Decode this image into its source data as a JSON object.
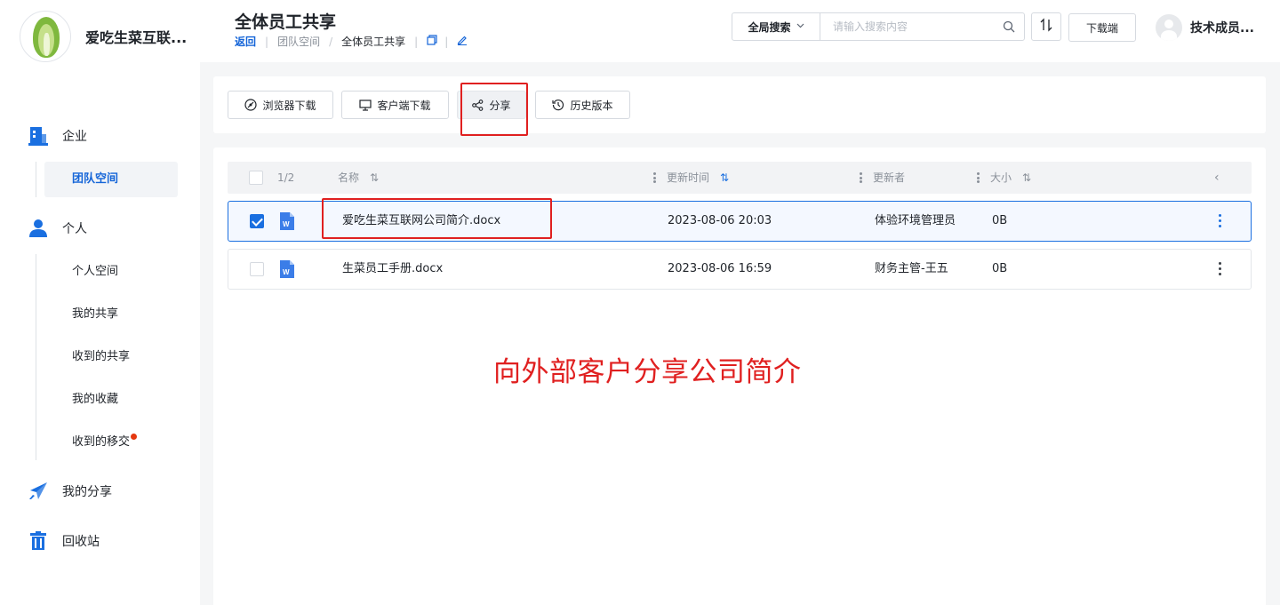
{
  "brand": {
    "name": "爱吃生菜互联...",
    "logo_icon": "lettuce-logo"
  },
  "sidebar": {
    "enterprise": {
      "label": "企业",
      "icon": "building-icon",
      "items": [
        {
          "label": "团队空间",
          "active": true
        }
      ]
    },
    "personal": {
      "label": "个人",
      "icon": "person-icon",
      "items": [
        {
          "label": "个人空间"
        },
        {
          "label": "我的共享"
        },
        {
          "label": "收到的共享"
        },
        {
          "label": "我的收藏"
        },
        {
          "label": "收到的移交",
          "badge": "dot"
        }
      ]
    },
    "my_share": {
      "label": "我的分享",
      "icon": "paper-plane-icon"
    },
    "recycle": {
      "label": "回收站",
      "icon": "trash-icon"
    }
  },
  "header": {
    "title": "全体员工共享",
    "breadcrumb": {
      "back": "返回",
      "items": [
        "团队空间",
        "全体员工共享"
      ]
    },
    "search": {
      "scope": "全局搜索",
      "placeholder": "请输入搜索内容"
    },
    "download_client": "下载端",
    "user_name": "技术成员..."
  },
  "toolbar": {
    "browser_download": "浏览器下载",
    "client_download": "客户端下载",
    "share": "分享",
    "history": "历史版本"
  },
  "table": {
    "count": "1/2",
    "columns": {
      "name": "名称",
      "updated": "更新时间",
      "updater": "更新者",
      "size": "大小"
    },
    "rows": [
      {
        "name": "爱吃生菜互联网公司简介.docx",
        "updated": "2023-08-06 20:03",
        "updater": "体验环境管理员",
        "size": "0B",
        "selected": true
      },
      {
        "name": "生菜员工手册.docx",
        "updated": "2023-08-06 16:59",
        "updater": "财务主管-王五",
        "size": "0B",
        "selected": false
      }
    ]
  },
  "annotation": "向外部客户分享公司简介",
  "colors": {
    "accent": "#1a6fe0",
    "annotation": "#e02020",
    "nav_icon": "#1a6fe0"
  }
}
